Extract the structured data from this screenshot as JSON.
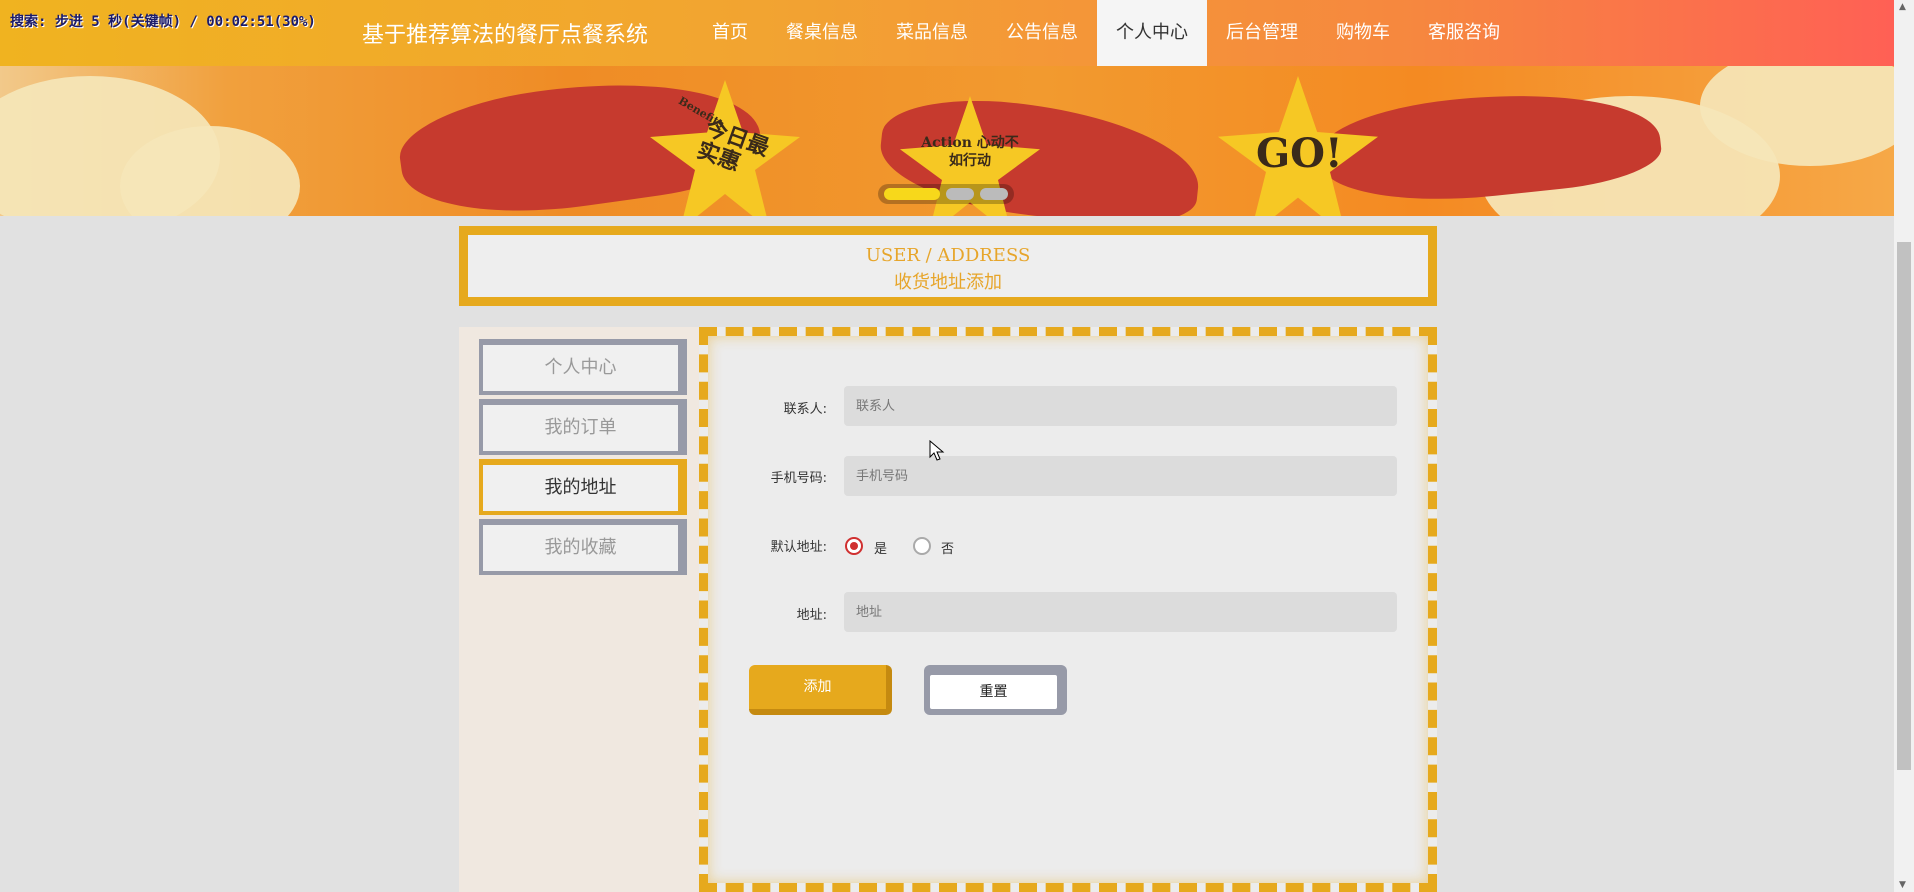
{
  "recorder": {
    "text": "搜索: 步进 5 秒(关键帧) / 00:02:51(30%)"
  },
  "header": {
    "site_title": "基于推荐算法的餐厅点餐系统",
    "nav": [
      {
        "label": "首页"
      },
      {
        "label": "餐桌信息"
      },
      {
        "label": "菜品信息"
      },
      {
        "label": "公告信息"
      },
      {
        "label": "个人中心",
        "active": true
      },
      {
        "label": "后台管理"
      },
      {
        "label": "购物车"
      },
      {
        "label": "客服咨询"
      }
    ]
  },
  "banner": {
    "star_texts": [
      "今日最实惠",
      "Benefits",
      "Action 心动不如行动",
      "GO!"
    ],
    "carousel": {
      "count": 3,
      "active": 1
    }
  },
  "page_title": {
    "en": "USER / ADDRESS",
    "cn": "收货地址添加"
  },
  "side_menu": [
    {
      "label": "个人中心"
    },
    {
      "label": "我的订单"
    },
    {
      "label": "我的地址",
      "active": true
    },
    {
      "label": "我的收藏"
    }
  ],
  "form": {
    "contact": {
      "label": "联系人:",
      "placeholder": "联系人",
      "value": ""
    },
    "phone": {
      "label": "手机号码:",
      "placeholder": "手机号码",
      "value": ""
    },
    "default": {
      "label": "默认地址:",
      "options": [
        "是",
        "否"
      ],
      "selected": "是"
    },
    "address": {
      "label": "地址:",
      "placeholder": "地址",
      "value": ""
    },
    "add_button": "添加",
    "reset_button": "重置"
  },
  "colors": {
    "accent": "#e6a91d",
    "gray_border": "#979aa8",
    "radio_checked": "#d03030"
  }
}
